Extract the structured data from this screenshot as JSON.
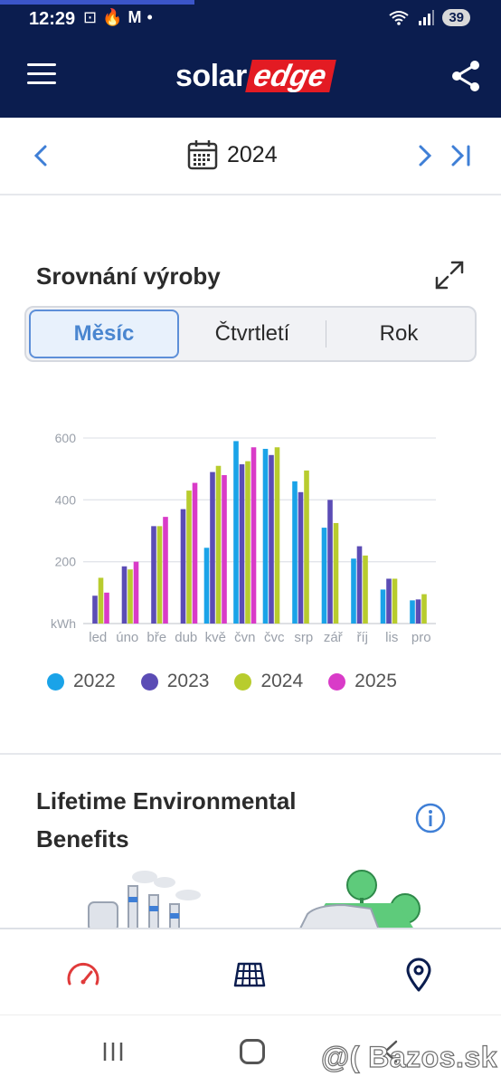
{
  "status_bar": {
    "time": "12:29",
    "battery": "39"
  },
  "header": {
    "logo_solar": "solar",
    "logo_edge": "edge"
  },
  "year_nav": {
    "year": "2024"
  },
  "production": {
    "title": "Srovnání výroby",
    "tabs": [
      {
        "label": "Měsíc",
        "active": true
      },
      {
        "label": "Čtvrtletí",
        "active": false
      },
      {
        "label": "Rok",
        "active": false
      }
    ]
  },
  "chart_data": {
    "type": "bar",
    "unit_label": "kWh",
    "categories": [
      "led",
      "úno",
      "bře",
      "dub",
      "kvě",
      "čvn",
      "čvc",
      "srp",
      "zář",
      "říj",
      "lis",
      "pro"
    ],
    "y_ticks": [
      "200",
      "400",
      "600"
    ],
    "ylim": [
      0,
      600
    ],
    "grid": true,
    "legend_position": "bottom",
    "series": [
      {
        "name": "2022",
        "color": "#1aa3e8",
        "values": [
          null,
          null,
          null,
          null,
          245,
          590,
          565,
          460,
          310,
          210,
          110,
          75
        ]
      },
      {
        "name": "2023",
        "color": "#5b4cb5",
        "values": [
          90,
          185,
          315,
          370,
          490,
          515,
          545,
          425,
          400,
          250,
          145,
          78
        ]
      },
      {
        "name": "2024",
        "color": "#b8cc2e",
        "values": [
          148,
          175,
          315,
          430,
          510,
          525,
          570,
          495,
          325,
          220,
          145,
          95
        ]
      },
      {
        "name": "2025",
        "color": "#d93bc8",
        "values": [
          100,
          200,
          345,
          455,
          480,
          570,
          null,
          null,
          null,
          null,
          null,
          null
        ]
      }
    ]
  },
  "environment": {
    "title": "Lifetime Environmental Benefits"
  },
  "bottom_nav": {
    "items": [
      "dashboard-icon",
      "layout-icon",
      "location-icon"
    ]
  },
  "watermark": "@( Bazos.sk"
}
